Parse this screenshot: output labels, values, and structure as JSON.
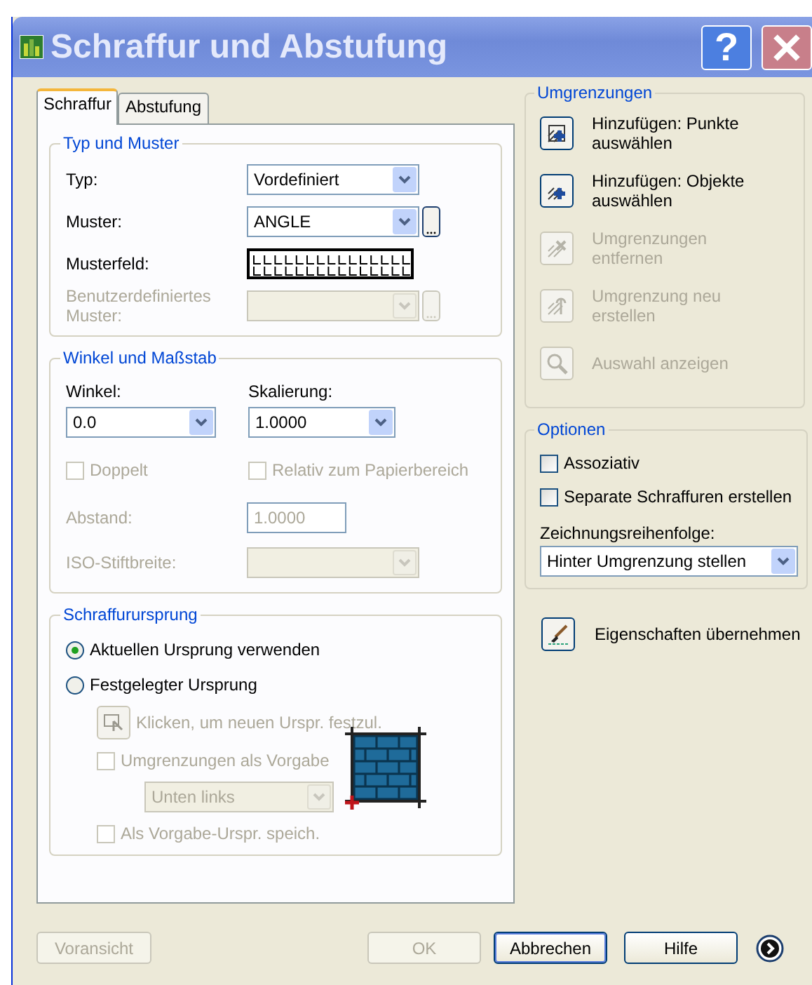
{
  "window": {
    "title": "Schraffur und Abstufung",
    "help_button": "?"
  },
  "tabs": [
    {
      "label": "Schraffur",
      "selected": true
    },
    {
      "label": "Abstufung",
      "selected": false
    }
  ],
  "type_and_pattern": {
    "title": "Typ und Muster",
    "fields": [
      {
        "kind": "select",
        "label": "Typ:",
        "value": "Vordefiniert",
        "disabled": false
      },
      {
        "kind": "select_browse",
        "label": "Muster:",
        "value": "ANGLE",
        "disabled": false
      },
      {
        "kind": "swatch",
        "label": "Musterfeld:",
        "disabled": false
      },
      {
        "kind": "select_browse",
        "label": "Benutzerdefiniertes Muster:",
        "disabled": true
      }
    ]
  },
  "angle_scale": {
    "title": "Winkel und Maßstab",
    "angle": {
      "label": "Winkel:",
      "value": "0.0"
    },
    "scale": {
      "label": "Skalierung:",
      "value": "1.0000"
    },
    "checkboxes": [
      {
        "label": "Doppelt",
        "checked": false,
        "disabled": true
      },
      {
        "label": "Relativ zum Papierbereich",
        "checked": false,
        "disabled": true
      }
    ],
    "spacing": {
      "label": "Abstand:",
      "value": "1.0000",
      "disabled": true
    },
    "iso_pen_width": {
      "label": "ISO-Stiftbreite:",
      "disabled": true
    }
  },
  "origin": {
    "title": "Schraffurursprung",
    "radios": [
      {
        "label": "Aktuellen Ursprung verwenden",
        "selected": true
      },
      {
        "label": "Festgelegter Ursprung",
        "selected": false
      }
    ],
    "pick_button": {
      "label": "Klicken, um neuen Urspr. festzul.",
      "disabled": true
    },
    "default_boundary": {
      "label": "Umgrenzungen als Vorgabe",
      "checked": false,
      "disabled": true
    },
    "position": {
      "value": "Unten links",
      "disabled": true
    },
    "store_default": {
      "label": "Als Vorgabe-Urspr. speich.",
      "checked": false,
      "disabled": true
    }
  },
  "boundaries": {
    "title": "Umgrenzungen",
    "items": [
      {
        "kind": "add_points",
        "label": "Hinzufügen: Punkte auswählen",
        "disabled": false
      },
      {
        "kind": "add_objects",
        "label": "Hinzufügen: Objekte auswählen",
        "disabled": false
      },
      {
        "kind": "remove",
        "label": "Umgrenzungen entfernen",
        "disabled": true
      },
      {
        "kind": "recreate",
        "label": "Umgrenzung neu erstellen",
        "disabled": true
      },
      {
        "kind": "view",
        "label": "Auswahl anzeigen",
        "disabled": true
      }
    ]
  },
  "options": {
    "title": "Optionen",
    "checkboxes": [
      {
        "label": "Assoziativ",
        "checked": false,
        "disabled": false
      },
      {
        "label": "Separate Schraffuren erstellen",
        "checked": false,
        "disabled": false
      }
    ],
    "draw_order": {
      "label": "Zeichnungsreihenfolge:",
      "value": "Hinter Umgrenzung stellen"
    }
  },
  "inherit": {
    "label": "Eigenschaften übernehmen"
  },
  "buttons": [
    {
      "label": "Voransicht",
      "disabled": true,
      "default": false
    },
    {
      "label": "OK",
      "disabled": true,
      "default": false
    },
    {
      "label": "Abbrechen",
      "disabled": false,
      "default": true
    },
    {
      "label": "Hilfe",
      "disabled": false,
      "default": false
    }
  ]
}
